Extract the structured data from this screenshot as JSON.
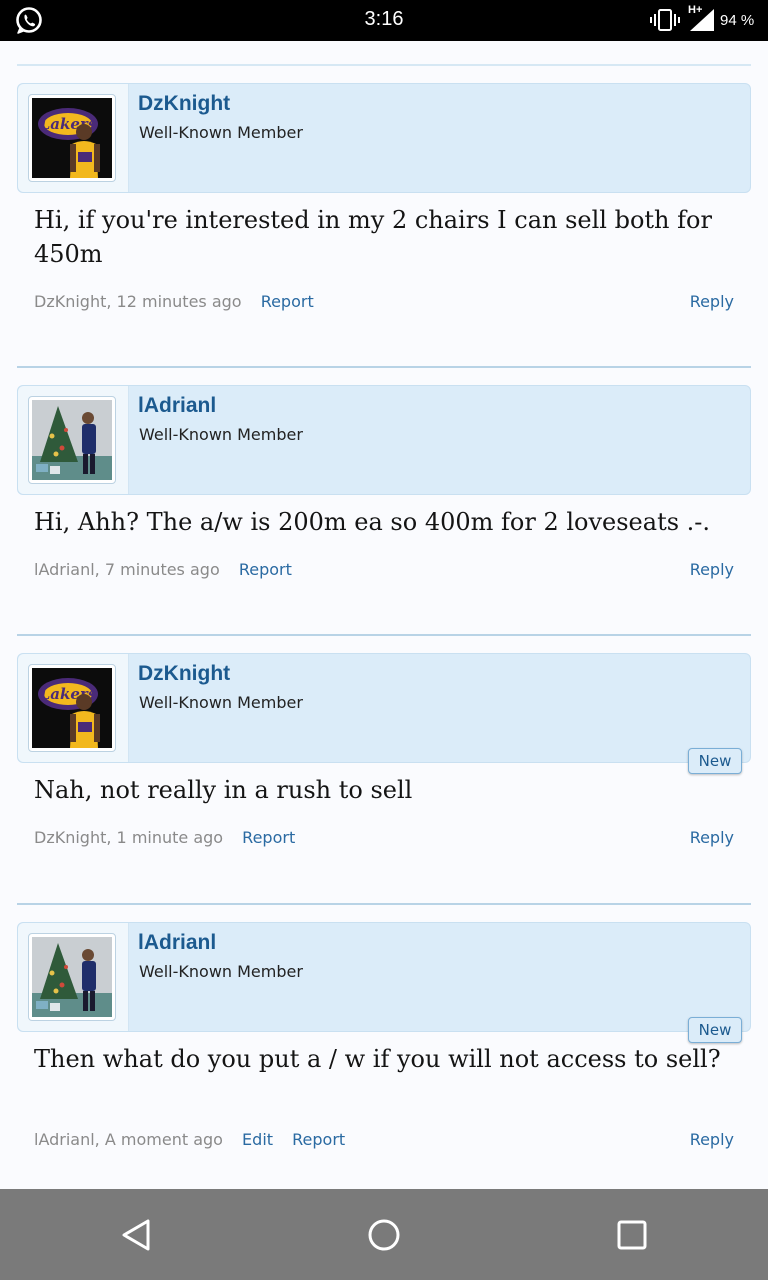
{
  "status_bar": {
    "time": "3:16",
    "network": "H+",
    "battery": "94 %",
    "icons": [
      "whatsapp-icon",
      "vibrate-icon",
      "signal-icon"
    ]
  },
  "posts": [
    {
      "username": "DzKnight",
      "user_title": "Well-Known Member",
      "avatar": "lakers-player-avatar",
      "message": "Hi, if you're interested in my 2 chairs I can sell both for 450m",
      "meta_author": "DzKnight,",
      "meta_time": "12 minutes ago",
      "report_label": "Report",
      "reply_label": "Reply"
    },
    {
      "username": "lAdrianl",
      "user_title": "Well-Known Member",
      "avatar": "christmas-tree-photo-avatar",
      "message": "Hi, Ahh? The a/w is 200m ea so 400m for 2 loveseats .-.",
      "meta_author": "lAdrianl,",
      "meta_time": "7 minutes ago",
      "report_label": "Report",
      "reply_label": "Reply"
    },
    {
      "username": "DzKnight",
      "user_title": "Well-Known Member",
      "avatar": "lakers-player-avatar",
      "message": "Nah, not really in a rush to sell",
      "meta_author": "DzKnight,",
      "meta_time": "1 minute ago",
      "report_label": "Report",
      "reply_label": "Reply",
      "badge": "New"
    },
    {
      "username": "lAdrianl",
      "user_title": "Well-Known Member",
      "avatar": "christmas-tree-photo-avatar",
      "message": "Then what do you put a / w if you will not access to sell?",
      "meta_author": "lAdrianl,",
      "meta_time": "A moment ago",
      "edit_label": "Edit",
      "report_label": "Report",
      "reply_label": "Reply",
      "badge": "New"
    }
  ],
  "nav_bar": {
    "buttons": [
      "back-icon",
      "home-icon",
      "recents-icon"
    ]
  },
  "colors": {
    "accent": "#1c5a8f",
    "link": "#2a6aa2",
    "user_block_bg": "#dbecf9",
    "nav_bg": "#7a7a7a"
  }
}
